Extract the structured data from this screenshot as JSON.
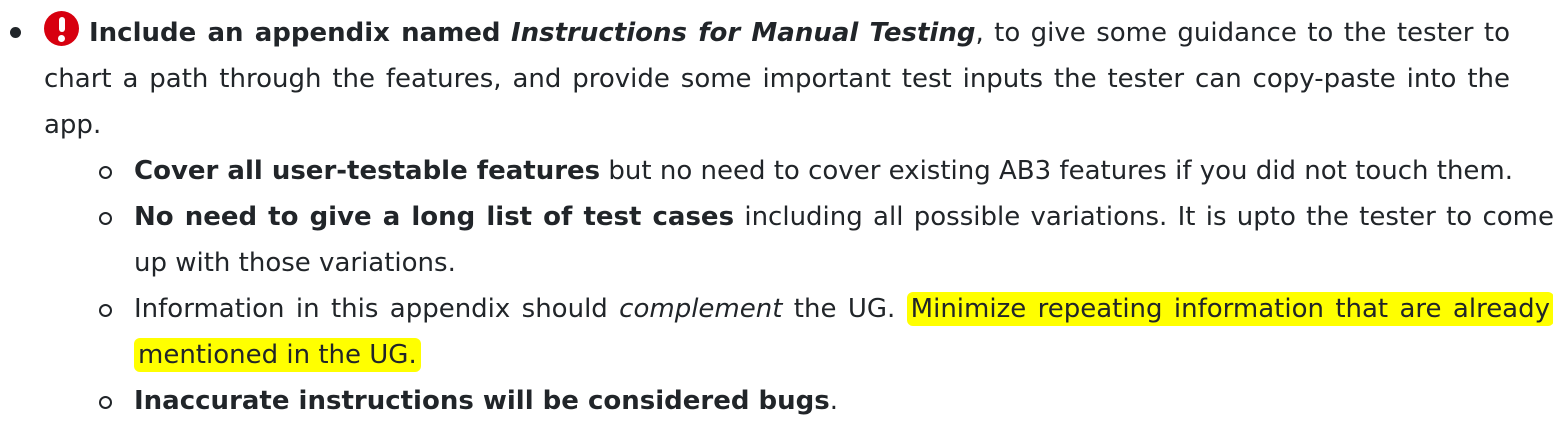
{
  "main_bullet": {
    "lead_bold": "Include an appendix named",
    "appendix_name": "Instructions for Manual Testing",
    "rest": ", to give some guidance to the tester to chart a path through the features, and provide some important test inputs the tester can copy-paste into the app.",
    "icon": "exclamation-circle-icon",
    "icon_color": "#d7000f"
  },
  "sub_bullets": [
    {
      "bold": "Cover all user-testable features",
      "text": " but no need to cover existing AB3 features if you did not touch them."
    },
    {
      "bold": "No need to give a long list of test cases",
      "text": " including all possible variations. It is upto the tester to come up with those variations."
    },
    {
      "pre": "Information in this appendix should ",
      "italic": "complement",
      "post": " the UG. ",
      "highlighted": "Minimize repeating information that are already mentioned in the UG.",
      "highlight_color": "#ffff00"
    },
    {
      "bold": "Inaccurate instructions will be considered bugs",
      "text": "."
    }
  ]
}
